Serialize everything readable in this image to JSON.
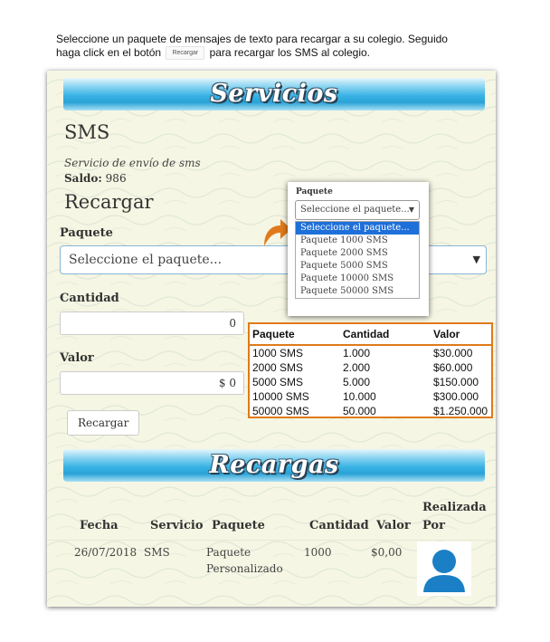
{
  "instructions": {
    "line1": "Seleccione un paquete de mensajes de texto para recargar a su colegio. Seguido",
    "line2a": "haga click en el botón",
    "inline_button": "Recargar",
    "line2b": "para recargar los SMS al colegio."
  },
  "servicios": {
    "banner": "Servicios",
    "sms_title": "SMS",
    "sms_desc": "Servicio de envío de sms",
    "saldo_label": "Saldo",
    "saldo_value": "986",
    "recargar_title": "Recargar",
    "paquete_label": "Paquete",
    "paquete_value": "Seleccione el paquete...",
    "cantidad_label": "Cantidad",
    "cantidad_value": "0",
    "valor_label": "Valor",
    "valor_value": "$ 0",
    "recargar_button": "Recargar"
  },
  "dropdown": {
    "label": "Paquete",
    "selected": "Seleccione el paquete...",
    "options": [
      "Seleccione el paquete...",
      "Paquete 1000 SMS",
      "Paquete 2000 SMS",
      "Paquete 5000 SMS",
      "Paquete 10000 SMS",
      "Paquete 50000 SMS"
    ]
  },
  "price_table": {
    "headers": [
      "Paquete",
      "Cantidad",
      "Valor"
    ],
    "rows": [
      [
        "1000 SMS",
        "1.000",
        "$30.000"
      ],
      [
        "2000 SMS",
        "2.000",
        "$60.000"
      ],
      [
        "5000 SMS",
        "5.000",
        "$150.000"
      ],
      [
        "10000 SMS",
        "10.000",
        "$300.000"
      ],
      [
        "50000 SMS",
        "50.000",
        "$1.250.000"
      ]
    ]
  },
  "recargas": {
    "banner": "Recargas",
    "headers": {
      "fecha": "Fecha",
      "servicio": "Servicio",
      "paquete": "Paquete",
      "cantidad": "Cantidad",
      "valor": "Valor",
      "realizada1": "Realizada",
      "realizada2": "Por"
    },
    "row": {
      "fecha": "26/07/2018",
      "servicio": "SMS",
      "paquete1": "Paquete",
      "paquete2": "Personalizado",
      "cantidad": "1000",
      "valor": "$0,00"
    }
  },
  "colors": {
    "accent_blue": "#2aa2d6",
    "highlight_orange": "#e07a1a",
    "avatar_blue": "#1a7fc4",
    "selected_option": "#1e6fd9"
  },
  "icons": [
    "curved-arrow-icon",
    "user-avatar-icon",
    "chevron-down-icon"
  ]
}
